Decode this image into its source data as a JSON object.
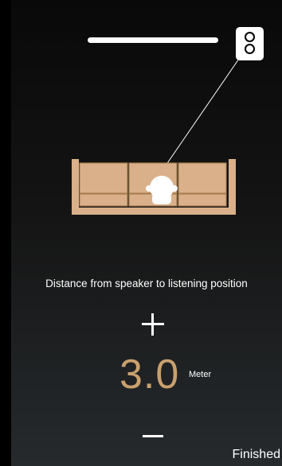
{
  "setup": {
    "instruction": "Distance from speaker to listening position",
    "distance_value": "3.0",
    "distance_unit": "Meter",
    "finish_label": "Finished"
  },
  "icons": {
    "increase": "plus-icon",
    "decrease": "minus-icon",
    "speaker": "speaker-icon",
    "tv": "tv-bar-icon",
    "sofa": "sofa-icon",
    "listener": "listener-head-icon"
  },
  "colors": {
    "accent": "#c9a06d",
    "sofa": "#d9b08a",
    "sofa_outline": "#b08656",
    "text": "#ffffff",
    "background": "#111111"
  }
}
